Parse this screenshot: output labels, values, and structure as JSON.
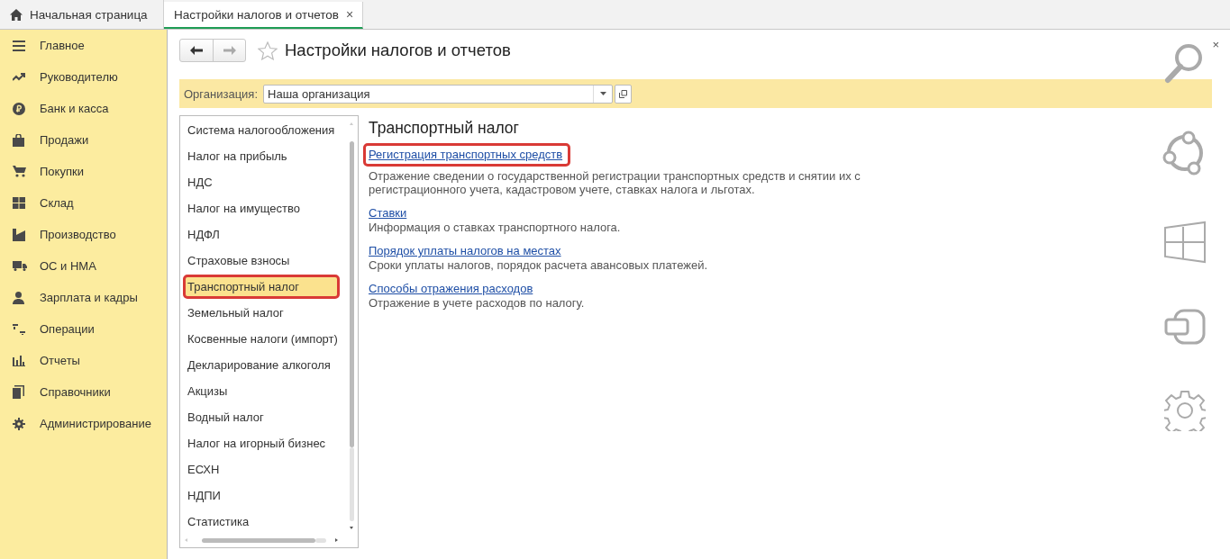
{
  "tabs": [
    {
      "label": "Начальная страница",
      "kind": "home",
      "selected": false
    },
    {
      "label": "Настройки налогов и отчетов",
      "kind": "page",
      "selected": true,
      "close": "×"
    }
  ],
  "sidebar": {
    "items": [
      {
        "label": "Главное"
      },
      {
        "label": "Руководителю"
      },
      {
        "label": "Банк и касса"
      },
      {
        "label": "Продажи"
      },
      {
        "label": "Покупки"
      },
      {
        "label": "Склад"
      },
      {
        "label": "Производство"
      },
      {
        "label": "ОС и НМА"
      },
      {
        "label": "Зарплата и кадры"
      },
      {
        "label": "Операции"
      },
      {
        "label": "Отчеты"
      },
      {
        "label": "Справочники"
      },
      {
        "label": "Администрирование"
      }
    ]
  },
  "page": {
    "title": "Настройки налогов и отчетов",
    "close": "×"
  },
  "organization": {
    "label": "Организация:",
    "value": "Наша организация"
  },
  "tax_list": [
    {
      "label": "Система налогообложения",
      "selected": false,
      "highlighted": false
    },
    {
      "label": "Налог на прибыль",
      "selected": false,
      "highlighted": false
    },
    {
      "label": "НДС",
      "selected": false,
      "highlighted": false
    },
    {
      "label": "Налог на имущество",
      "selected": false,
      "highlighted": false
    },
    {
      "label": "НДФЛ",
      "selected": false,
      "highlighted": false
    },
    {
      "label": "Страховые взносы",
      "selected": false,
      "highlighted": false
    },
    {
      "label": "Транспортный налог",
      "selected": true,
      "highlighted": true
    },
    {
      "label": "Земельный налог",
      "selected": false,
      "highlighted": false
    },
    {
      "label": "Косвенные налоги (импорт)",
      "selected": false,
      "highlighted": false
    },
    {
      "label": "Декларирование алкоголя",
      "selected": false,
      "highlighted": false
    },
    {
      "label": "Акцизы",
      "selected": false,
      "highlighted": false
    },
    {
      "label": "Водный налог",
      "selected": false,
      "highlighted": false
    },
    {
      "label": "Налог на игорный бизнес",
      "selected": false,
      "highlighted": false
    },
    {
      "label": "ЕСХН",
      "selected": false,
      "highlighted": false
    },
    {
      "label": "НДПИ",
      "selected": false,
      "highlighted": false
    },
    {
      "label": "Статистика",
      "selected": false,
      "highlighted": false
    }
  ],
  "section": {
    "title": "Транспортный налог",
    "links": [
      {
        "label": "Регистрация транспортных средств",
        "description": "Отражение сведении о государственной регистрации транспортных средств и снятии их с регистрационного учета, кадастровом учете, ставках налога и льготах.",
        "highlighted": true
      },
      {
        "label": "Ставки",
        "description": "Информация о ставках транспортного налога.",
        "highlighted": false
      },
      {
        "label": "Порядок уплаты налогов на местах",
        "description": "Сроки уплаты налогов, порядок расчета авансовых платежей.",
        "highlighted": false
      },
      {
        "label": "Способы отражения расходов",
        "description": "Отражение в учете расходов по налогу.",
        "highlighted": false
      }
    ]
  }
}
